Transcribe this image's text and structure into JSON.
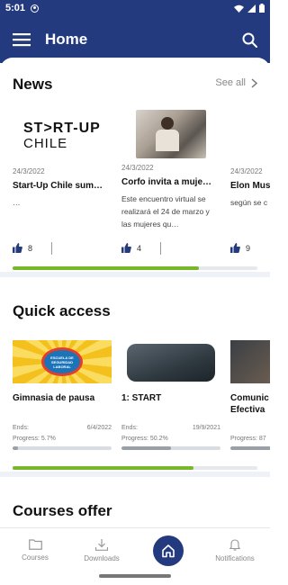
{
  "status": {
    "time": "5:01"
  },
  "appbar": {
    "title": "Home"
  },
  "news": {
    "title": "News",
    "see_all": "See all",
    "items": [
      {
        "date": "24/3/2022",
        "title": "Start-Up Chile sum…",
        "excerpt": "…",
        "likes": "8",
        "logo_line1": "ST>RT-UP",
        "logo_line2": "CHILE"
      },
      {
        "date": "24/3/2022",
        "title": "Corfo invita a muje…",
        "excerpt": "Este encuentro virtual se realizará el 24 de marzo y las mujeres qu…",
        "likes": "4"
      },
      {
        "date": "24/3/2022",
        "title": "Elon Mus",
        "excerpt": "según se c",
        "likes": "9"
      }
    ],
    "scroll_progress": 0.76
  },
  "quick_access": {
    "title": "Quick access",
    "items": [
      {
        "title": "Gimnasia de pausa",
        "ends_label": "Ends:",
        "ends": "6/4/2022",
        "progress_label": "Progress: 5.7%",
        "progress": 0.057,
        "badge_text": "ESCUELA DE SEGURIDAD LABORAL"
      },
      {
        "title": "1: START",
        "ends_label": "Ends:",
        "ends": "19/9/2021",
        "progress_label": "Progress: 50.2%",
        "progress": 0.502
      },
      {
        "title": "Comunic Efectiva",
        "progress_label": "Progress: 87",
        "progress": 0.87
      }
    ],
    "scroll_progress": 0.74
  },
  "courses": {
    "title": "Courses offer"
  },
  "bottom_nav": {
    "courses": "Courses",
    "downloads": "Downloads",
    "notifications": "Notifications"
  },
  "colors": {
    "primary": "#233a7e",
    "accent": "#76b82a"
  }
}
